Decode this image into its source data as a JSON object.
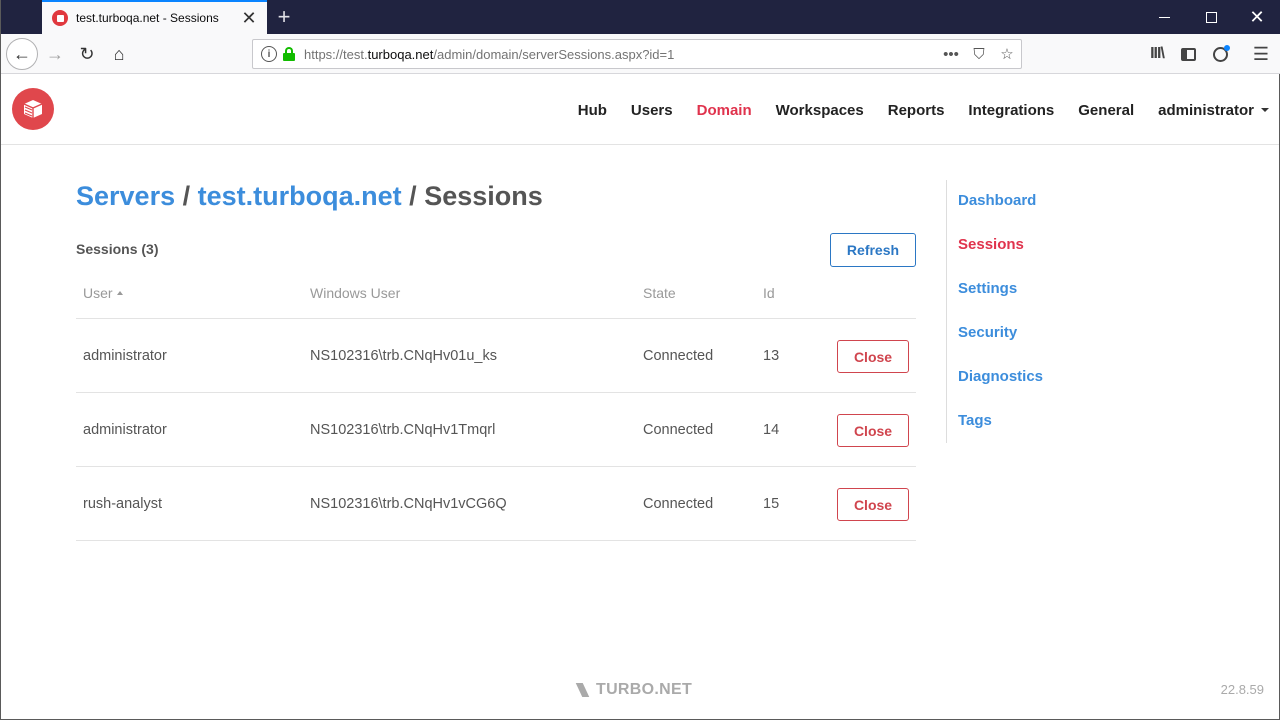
{
  "browser": {
    "tab_title": "test.turboqa.net - Sessions",
    "new_tab_label": "+",
    "url_prefix": "https://test.",
    "url_domain": "turboqa.net",
    "url_path": "/admin/domain/serverSessions.aspx?id=1",
    "accent": "#0a84ff"
  },
  "header": {
    "nav": [
      {
        "label": "Hub",
        "active": false
      },
      {
        "label": "Users",
        "active": false
      },
      {
        "label": "Domain",
        "active": true
      },
      {
        "label": "Workspaces",
        "active": false
      },
      {
        "label": "Reports",
        "active": false
      },
      {
        "label": "Integrations",
        "active": false
      },
      {
        "label": "General",
        "active": false
      }
    ],
    "user_menu_label": "administrator",
    "active_color": "#e0334d"
  },
  "breadcrumb": {
    "servers": "Servers",
    "separator": "/",
    "server": "test.turboqa.net",
    "current": "Sessions"
  },
  "sessions": {
    "count_label": "Sessions (3)",
    "refresh_label": "Refresh",
    "columns": {
      "user": "User",
      "windows_user": "Windows User",
      "state": "State",
      "id": "Id"
    },
    "rows": [
      {
        "user": "administrator",
        "windows_user": "NS102316\\trb.CNqHv01u_ks",
        "state": "Connected",
        "id": "13",
        "action": "Close"
      },
      {
        "user": "administrator",
        "windows_user": "NS102316\\trb.CNqHv1Tmqrl",
        "state": "Connected",
        "id": "14",
        "action": "Close"
      },
      {
        "user": "rush-analyst",
        "windows_user": "NS102316\\trb.CNqHv1vCG6Q",
        "state": "Connected",
        "id": "15",
        "action": "Close"
      }
    ]
  },
  "side_menu": {
    "items": [
      {
        "label": "Dashboard",
        "active": false
      },
      {
        "label": "Sessions",
        "active": true
      },
      {
        "label": "Settings",
        "active": false
      },
      {
        "label": "Security",
        "active": false
      },
      {
        "label": "Diagnostics",
        "active": false
      },
      {
        "label": "Tags",
        "active": false
      }
    ]
  },
  "footer": {
    "brand": "TURBO.NET",
    "version": "22.8.59"
  }
}
